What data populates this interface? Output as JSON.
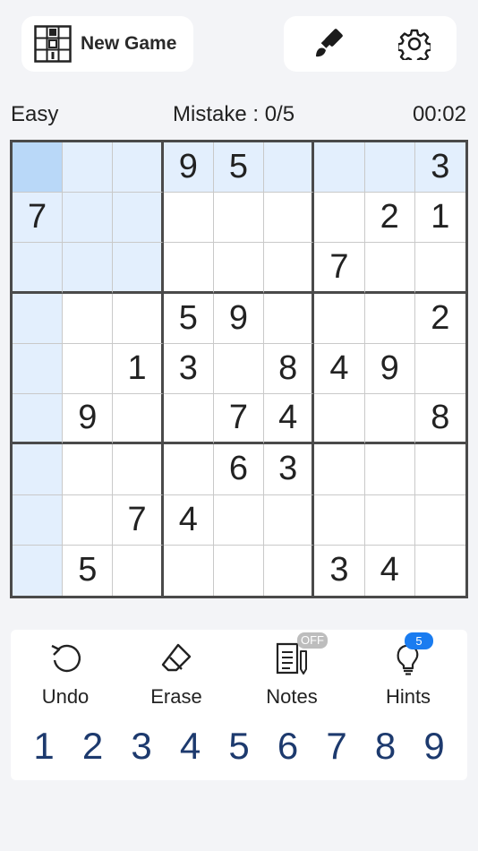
{
  "header": {
    "new_game_label": "New Game",
    "icons": [
      "game-grid-icon",
      "paint-brush-icon",
      "gear-icon"
    ]
  },
  "status": {
    "difficulty": "Easy",
    "mistakes": "Mistake : 0/5",
    "timer": "00:02"
  },
  "board": {
    "selected": [
      0,
      0
    ],
    "grid": [
      [
        "",
        "",
        "",
        "9",
        "5",
        "",
        "",
        "",
        "3"
      ],
      [
        "7",
        "",
        "",
        "",
        "",
        "",
        "",
        "2",
        "1"
      ],
      [
        "",
        "",
        "",
        "",
        "",
        "",
        "7",
        "",
        ""
      ],
      [
        "",
        "",
        "",
        "5",
        "9",
        "",
        "",
        "",
        "2"
      ],
      [
        "",
        "",
        "1",
        "3",
        "",
        "8",
        "4",
        "9",
        ""
      ],
      [
        "",
        "9",
        "",
        "",
        "7",
        "4",
        "",
        "",
        "8"
      ],
      [
        "",
        "",
        "",
        "",
        "6",
        "3",
        "",
        "",
        ""
      ],
      [
        "",
        "",
        "7",
        "4",
        "",
        "",
        "",
        "",
        ""
      ],
      [
        "",
        "5",
        "",
        "",
        "",
        "",
        "3",
        "4",
        ""
      ]
    ],
    "colors": {
      "selected": "#b9d8f8",
      "highlight": "#e3effd",
      "border": "#4a4a4a"
    }
  },
  "actions": [
    {
      "label": "Undo",
      "icon": "undo-icon"
    },
    {
      "label": "Erase",
      "icon": "eraser-icon"
    },
    {
      "label": "Notes",
      "icon": "notes-icon",
      "badge": "OFF"
    },
    {
      "label": "Hints",
      "icon": "lightbulb-icon",
      "badge": "5"
    }
  ],
  "numpad": [
    "1",
    "2",
    "3",
    "4",
    "5",
    "6",
    "7",
    "8",
    "9"
  ],
  "colors": {
    "accent": "#1a7cf0",
    "numpad_text": "#1d3a6e",
    "background": "#f3f4f7"
  }
}
